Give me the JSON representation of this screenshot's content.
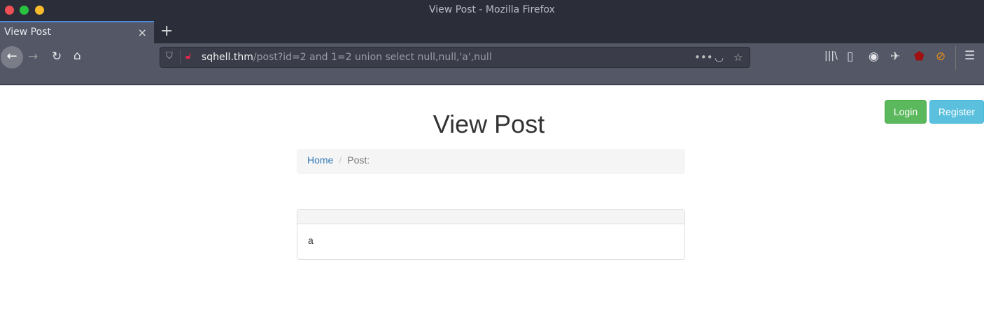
{
  "window": {
    "title": "View Post - Mozilla Firefox"
  },
  "tab": {
    "label": "View Post",
    "close": "×",
    "new_tab": "+"
  },
  "urlbar": {
    "host": "sqhell.thm",
    "path": "/post?id=2 and 1=2 union select null,null,'a',null"
  },
  "page": {
    "title": "View Post",
    "login": "Login",
    "register": "Register",
    "breadcrumb": {
      "home": "Home",
      "separator": "/",
      "current": "Post:"
    },
    "panel_body": "a"
  },
  "colors": {
    "login": "#5cb85c",
    "register": "#5bc0de",
    "link": "#337ab7"
  }
}
